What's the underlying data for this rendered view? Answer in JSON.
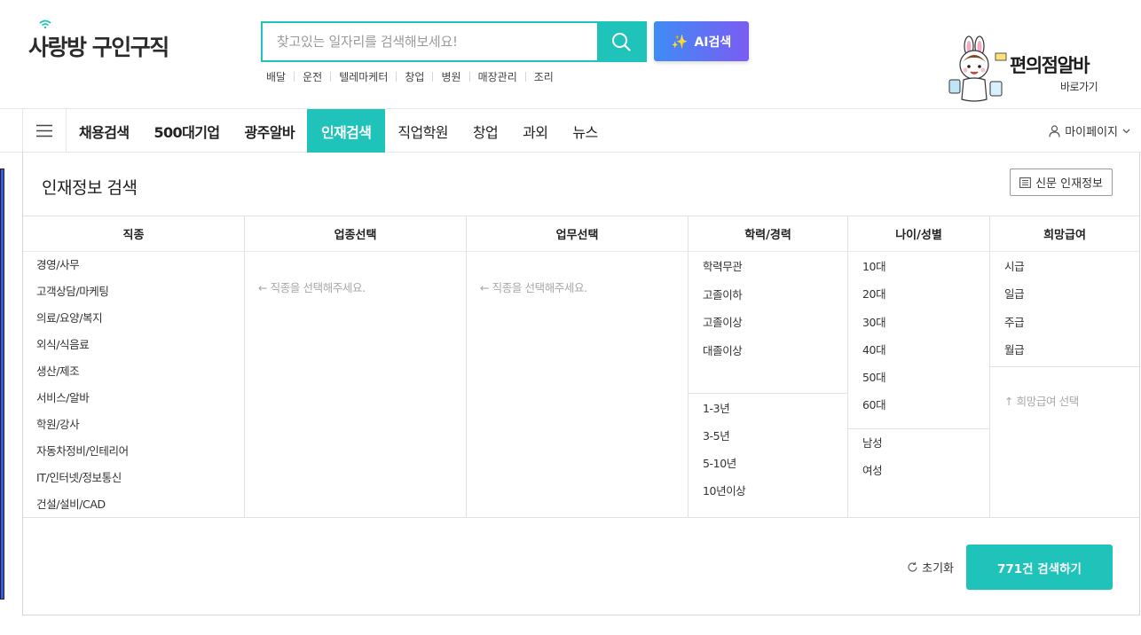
{
  "brand": {
    "logo_text": "사랑방 구인구직"
  },
  "search": {
    "placeholder": "찾고있는 일자리를 검색해보세요!",
    "value": ""
  },
  "ai_search": {
    "label": "AI검색"
  },
  "quick_links": [
    "배달",
    "운전",
    "텔레마케터",
    "창업",
    "병원",
    "매장관리",
    "조리"
  ],
  "promo": {
    "title": "편의점알바",
    "subtitle": "바로가기"
  },
  "nav": {
    "items": [
      {
        "label": "채용검색",
        "bold": true,
        "active": false
      },
      {
        "label": "500대기업",
        "bold": true,
        "active": false
      },
      {
        "label": "광주알바",
        "bold": true,
        "active": false
      },
      {
        "label": "인재검색",
        "bold": true,
        "active": true
      },
      {
        "label": "직업학원",
        "bold": false,
        "active": false
      },
      {
        "label": "창업",
        "bold": false,
        "active": false
      },
      {
        "label": "과외",
        "bold": false,
        "active": false
      },
      {
        "label": "뉴스",
        "bold": false,
        "active": false
      }
    ],
    "mypage": "마이페이지"
  },
  "panel": {
    "title": "인재정보 검색",
    "news_button": "신문 인재정보",
    "columns": {
      "job": {
        "title": "직종",
        "items": [
          "경영/사무",
          "고객상담/마케팅",
          "의료/요양/복지",
          "외식/식음료",
          "생산/제조",
          "서비스/알바",
          "학원/강사",
          "자동차정비/인테리어",
          "IT/인터넷/정보통신",
          "건설/설비/CAD"
        ]
      },
      "industry": {
        "title": "업종선택",
        "hint": "← 직종을 선택해주세요."
      },
      "duty": {
        "title": "업무선택",
        "hint": "← 직종을 선택해주세요."
      },
      "edu": {
        "title": "학력/경력",
        "education": [
          "학력무관",
          "고졸이하",
          "고졸이상",
          "대졸이상"
        ],
        "career": [
          "1-3년",
          "3-5년",
          "5-10년",
          "10년이상"
        ]
      },
      "age": {
        "title": "나이/성별",
        "ages": [
          "10대",
          "20대",
          "30대",
          "40대",
          "50대",
          "60대"
        ],
        "genders": [
          "남성",
          "여성"
        ]
      },
      "salary": {
        "title": "희망급여",
        "types": [
          "시급",
          "일급",
          "주급",
          "월급"
        ],
        "hint": "↑ 희망급여 선택"
      }
    },
    "reset_label": "초기화",
    "submit_label": "771건 검색하기"
  },
  "colors": {
    "accent": "#1fc3b9",
    "ai_gradient_start": "#3f8cf5",
    "ai_gradient_end": "#7b5cf2"
  }
}
